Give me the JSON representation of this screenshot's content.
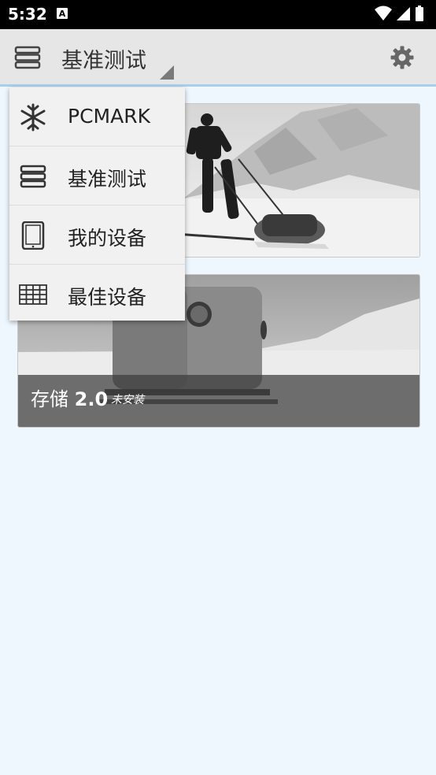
{
  "status_bar": {
    "time": "5:32",
    "notification_icon": "A",
    "icons": [
      "wifi-icon",
      "signal-icon",
      "battery-icon"
    ]
  },
  "app_bar": {
    "title": "基准测试",
    "menu_icon": "stacked-layers-icon",
    "settings_icon": "gear-icon",
    "accent_color": "#a8d0ec"
  },
  "cards": [
    {
      "title": "",
      "version": "",
      "subtitle": "",
      "image": "skier-pulling-sled-photo"
    },
    {
      "title": "存储",
      "version": "2.0",
      "subtitle": "未安装",
      "image": "arctic-cabin-sled-photo"
    }
  ],
  "menu": {
    "items": [
      {
        "label": "PCMARK",
        "icon": "snowflake-icon"
      },
      {
        "label": "基准测试",
        "icon": "stacked-layers-icon"
      },
      {
        "label": "我的设备",
        "icon": "tablet-icon"
      },
      {
        "label": "最佳设备",
        "icon": "grid-table-icon"
      }
    ]
  }
}
